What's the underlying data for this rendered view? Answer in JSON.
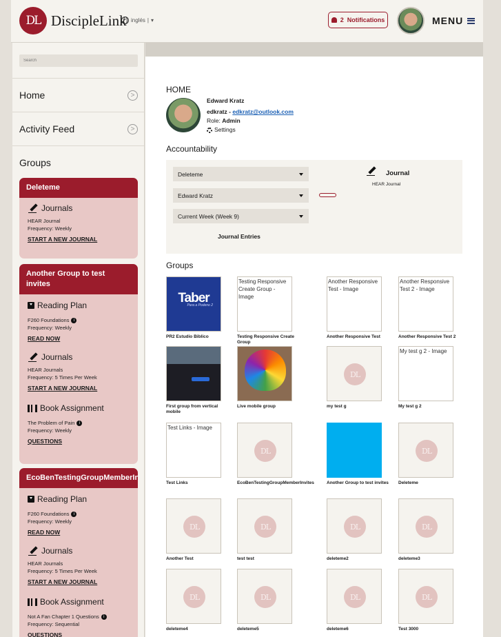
{
  "header": {
    "logo_mark": "DL",
    "brand": "DiscipleLink",
    "language": "inglés",
    "notifications_count": "2",
    "notifications_label": "Notifications",
    "menu_label": "MENU"
  },
  "sidebar": {
    "search_placeholder": "Search",
    "nav": [
      {
        "label": "Home"
      },
      {
        "label": "Activity Feed"
      }
    ],
    "groups_label": "Groups",
    "cards": [
      {
        "title": "Deleteme",
        "sections": [
          {
            "title": "Journals",
            "line1": "HEAR Journal",
            "line2": "Frequency: Weekly",
            "link": "START A NEW JOURNAL"
          }
        ]
      },
      {
        "title": "Another Group to test invites",
        "sections": [
          {
            "title": "Reading Plan",
            "line1": "F260 Foundations",
            "line2": "Frequency: Weekly",
            "link": "READ NOW"
          },
          {
            "title": "Journals",
            "line1": "HEAR Journals",
            "line2": "Frequency: 5 Times Per Week",
            "link": "START A NEW JOURNAL"
          },
          {
            "title": "Book Assignment",
            "line1": "The Problem of Pain",
            "line2": "Frequency: Weekly",
            "link": "QUESTIONS"
          }
        ]
      },
      {
        "title": "EcoBenTestingGroupMemberInvites",
        "sections": [
          {
            "title": "Reading Plan",
            "line1": "F260 Foundations",
            "line2": "Frequency: Weekly",
            "link": "READ NOW"
          },
          {
            "title": "Journals",
            "line1": "HEAR Journals",
            "line2": "Frequency: 5 Times Per Week",
            "link": "START A NEW JOURNAL"
          },
          {
            "title": "Book Assignment",
            "line1": "Not A Fan Chapter 1 Questions",
            "line2": "Frequency: Sequential",
            "link": "QUESTIONS"
          }
        ]
      }
    ]
  },
  "main": {
    "home_title": "HOME",
    "profile": {
      "name": "Edward Kratz",
      "username": "edkratz - ",
      "email": "edkratz@outlook.com",
      "role_label": "Role: ",
      "role": "Admin",
      "settings": "Settings"
    },
    "accountability": {
      "title": "Accountability",
      "group_select": "Deleteme",
      "person_select": "Edward Kratz",
      "week_select": "Current Week (Week 9)",
      "journal_entries": "Journal Entries",
      "journal_title": "Journal",
      "journal_sub": "HEAR Journal"
    },
    "groups_title": "Groups",
    "groups": [
      {
        "caption": "PR2 Estudio Biblico",
        "alt": "",
        "kind": "taber"
      },
      {
        "caption": "Testing Responsive Create Group",
        "alt": "Testing Responsive Create Group - Image",
        "kind": "broken"
      },
      {
        "caption": "Another Responsive Test",
        "alt": "Another Responsive Test - Image",
        "kind": "broken"
      },
      {
        "caption": "Another Responsive Test 2",
        "alt": "Another Responsive Test 2 - Image",
        "kind": "broken"
      },
      {
        "caption": "First group from vertical mobile",
        "alt": "",
        "kind": "screen"
      },
      {
        "caption": "Live mobile group",
        "alt": "",
        "kind": "balloon"
      },
      {
        "caption": "my test g",
        "alt": "",
        "kind": "placeholder"
      },
      {
        "caption": "My test g 2",
        "alt": "My test g 2 - Image",
        "kind": "broken"
      },
      {
        "caption": "Test Links",
        "alt": "Test Links - Image",
        "kind": "broken"
      },
      {
        "caption": "EcoBenTestingGroupMemberInvites",
        "alt": "",
        "kind": "placeholder"
      },
      {
        "caption": "Another Group to test invites",
        "alt": "",
        "kind": "blue"
      },
      {
        "caption": "Deleteme",
        "alt": "",
        "kind": "placeholder"
      },
      {
        "caption": "Another Test",
        "alt": "",
        "kind": "placeholder"
      },
      {
        "caption": "test test",
        "alt": "",
        "kind": "placeholder"
      },
      {
        "caption": "deleteme2",
        "alt": "",
        "kind": "placeholder"
      },
      {
        "caption": "deleteme3",
        "alt": "",
        "kind": "placeholder"
      },
      {
        "caption": "deleteme4",
        "alt": "",
        "kind": "placeholder"
      },
      {
        "caption": "deleteme5",
        "alt": "",
        "kind": "placeholder"
      },
      {
        "caption": "deleteme6",
        "alt": "",
        "kind": "placeholder"
      },
      {
        "caption": "Test 3000",
        "alt": "",
        "kind": "placeholder"
      }
    ],
    "taber_text": "Taber",
    "taber_sub": "Para  a Podeno 2"
  }
}
